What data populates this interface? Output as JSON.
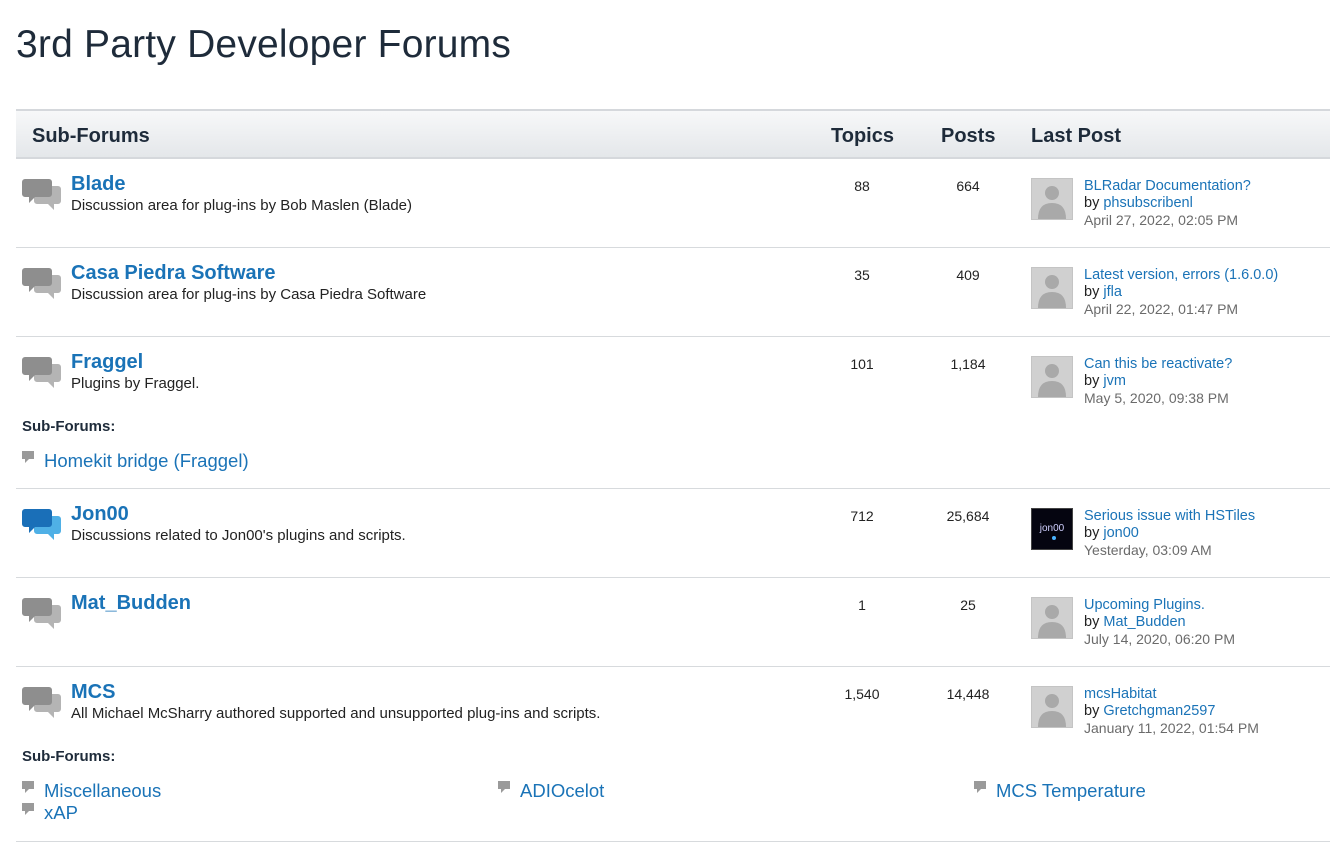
{
  "page": {
    "title": "3rd Party Developer Forums"
  },
  "table": {
    "headers": {
      "subforums": "Sub-Forums",
      "topics": "Topics",
      "posts": "Posts",
      "last_post": "Last Post"
    }
  },
  "forums": [
    {
      "name": "Blade",
      "description": "Discussion area for plug-ins by Bob Maslen (Blade)",
      "topics": "88",
      "posts": "664",
      "last_post": {
        "title": "BLRadar Documentation?",
        "by": "by",
        "user": "phsubscribenl",
        "date": "April 27, 2022, 02:05 PM"
      },
      "icon": "speech-bubbles-icon"
    },
    {
      "name": "Casa Piedra Software",
      "description": "Discussion area for plug-ins by Casa Piedra Software",
      "topics": "35",
      "posts": "409",
      "last_post": {
        "title": "Latest version, errors (1.6.0.0)",
        "by": "by",
        "user": "jfla",
        "date": "April 22, 2022, 01:47 PM"
      },
      "icon": "speech-bubbles-icon"
    },
    {
      "name": "Fraggel",
      "description": "Plugins by Fraggel.",
      "topics": "101",
      "posts": "1,184",
      "last_post": {
        "title": "Can this be reactivate?",
        "by": "by",
        "user": "jvm",
        "date": "May 5, 2020, 09:38 PM"
      },
      "subforums_label": "Sub-Forums:",
      "subforums": [
        "Homekit bridge (Fraggel)"
      ],
      "icon": "speech-bubbles-icon"
    },
    {
      "name": "Jon00",
      "description": "Discussions related to Jon00's plugins and scripts.",
      "topics": "712",
      "posts": "25,684",
      "last_post": {
        "title": "Serious issue with HSTiles",
        "by": "by",
        "user": "jon00",
        "date": "Yesterday, 03:09 AM"
      },
      "avatar_text": "jon00",
      "icon": "speech-bubbles-new-icon"
    },
    {
      "name": "Mat_Budden",
      "description": "",
      "topics": "1",
      "posts": "25",
      "last_post": {
        "title": "Upcoming Plugins.",
        "by": "by",
        "user": "Mat_Budden",
        "date": "July 14, 2020, 06:20 PM"
      },
      "icon": "speech-bubbles-icon"
    },
    {
      "name": "MCS",
      "description": "All Michael McSharry authored supported and unsupported plug-ins and scripts.",
      "topics": "1,540",
      "posts": "14,448",
      "last_post": {
        "title": "mcsHabitat",
        "by": "by",
        "user": "Gretchgman2597",
        "date": "January 11, 2022, 01:54 PM"
      },
      "subforums_label": "Sub-Forums:",
      "subforums": [
        "Miscellaneous",
        "ADIOcelot",
        "MCS Temperature",
        "xAP"
      ],
      "icon": "speech-bubbles-icon"
    }
  ],
  "colors": {
    "link": "#1a73b7",
    "title": "#1e2b3a",
    "icon_gray": "#9a9a9a",
    "icon_blue": "#1a73b7"
  }
}
